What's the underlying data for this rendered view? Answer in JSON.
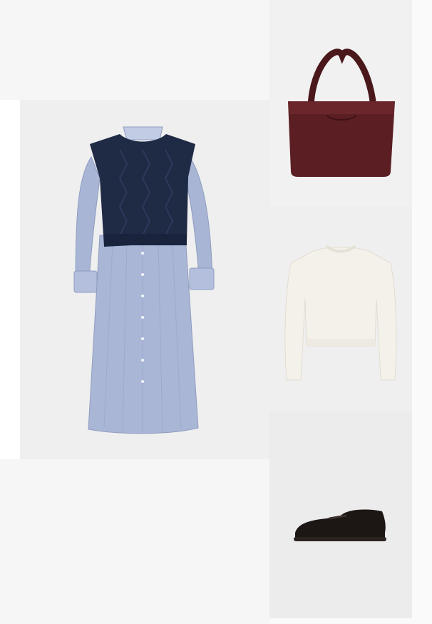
{
  "outfit": {
    "items": [
      {
        "id": "dress",
        "image_name": "shirt-dress-with-cable-knit-vest"
      },
      {
        "id": "bag",
        "image_name": "burgundy-leather-tote-bag"
      },
      {
        "id": "sweater",
        "image_name": "cream-knit-sweater"
      },
      {
        "id": "loafer",
        "image_name": "black-leather-loafer"
      }
    ]
  },
  "colors": {
    "page_bg": "#ffffff",
    "tile_bg": "#efefef",
    "dress_blue": "#a9b6d6",
    "vest_navy": "#1f2a45",
    "bag_burgundy": "#5b1e22",
    "sweater_cream": "#f4f1ea",
    "loafer_black": "#1c1614"
  }
}
